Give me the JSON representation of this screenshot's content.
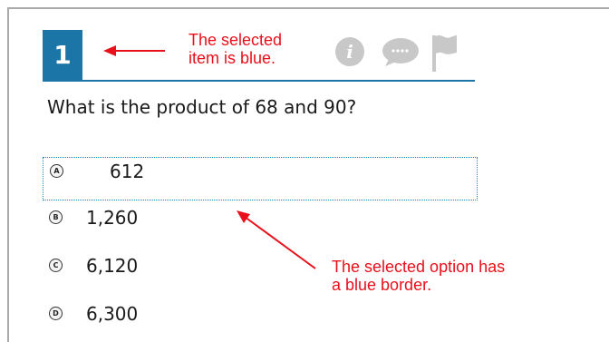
{
  "item": {
    "number": "1",
    "accent_color": "#1b75a6"
  },
  "toolbar": {
    "icons": [
      "info-icon",
      "comment-icon",
      "flag-icon"
    ]
  },
  "question": {
    "text": "What is the product of 68 and 90?"
  },
  "options": [
    {
      "letter": "A",
      "text": "612",
      "selected": true
    },
    {
      "letter": "B",
      "text": "1,260",
      "selected": false
    },
    {
      "letter": "C",
      "text": "6,120",
      "selected": false
    },
    {
      "letter": "D",
      "text": "6,300",
      "selected": false
    }
  ],
  "annotations": {
    "item_note_line1": "The selected",
    "item_note_line2": "item is blue.",
    "option_note_line1": "The selected option has",
    "option_note_line2": "a blue border.",
    "color": "#e8101a"
  }
}
